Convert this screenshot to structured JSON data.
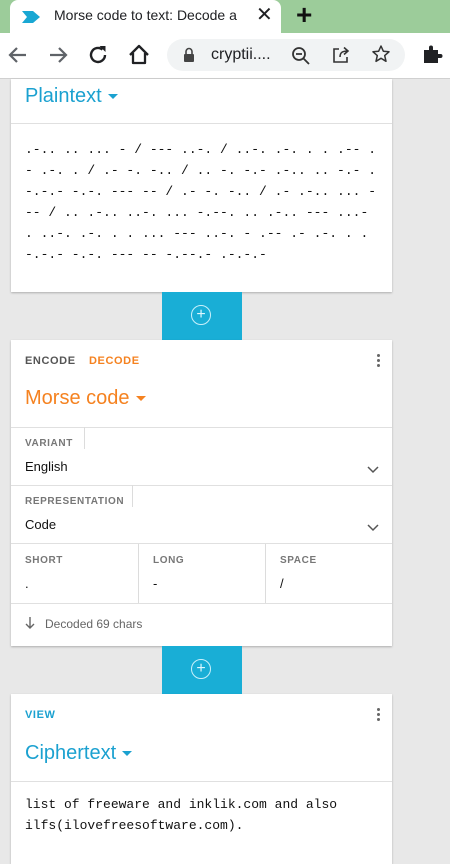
{
  "browser": {
    "tab_title": "Morse code to text: Decode a",
    "tab_close": "✕",
    "new_tab": "+",
    "url": "cryptii...."
  },
  "plaintext_card": {
    "title": "Plaintext",
    "content": ".-.. .. ... - / --- ..-. / ..-. .-. . . .-- .- .-. . / .- -. -.. / .. -. -.- .-.. .. -.- .-.-.- -.-. --- -- / .- -. -.. / .- .-.. ... --- / .. .-.. ..-. ... -.--. .. .-.. --- ...- . ..-. .-. . . ... --- ..-. - .-- .- .-. . .-.-.- -.-. --- -- -.--.- .-.-.-"
  },
  "morse_card": {
    "tab_encode": "ENCODE",
    "tab_decode": "DECODE",
    "title": "Morse code",
    "variant_label": "VARIANT",
    "variant_value": "English",
    "representation_label": "REPRESENTATION",
    "representation_value": "Code",
    "short_label": "SHORT",
    "short_value": ".",
    "long_label": "LONG",
    "long_value": "-",
    "space_label": "SPACE",
    "space_value": "/",
    "status": "Decoded 69 chars"
  },
  "ciphertext_card": {
    "view_label": "VIEW",
    "title": "Ciphertext",
    "content": "list of freeware and inklik.com and also ilfs(ilovefreesoftware.com)."
  },
  "colors": {
    "accent_blue": "#1ba1d0",
    "accent_orange": "#f58220",
    "strip_cyan": "#19aed6",
    "tabbar_green": "#9ccc9a"
  }
}
